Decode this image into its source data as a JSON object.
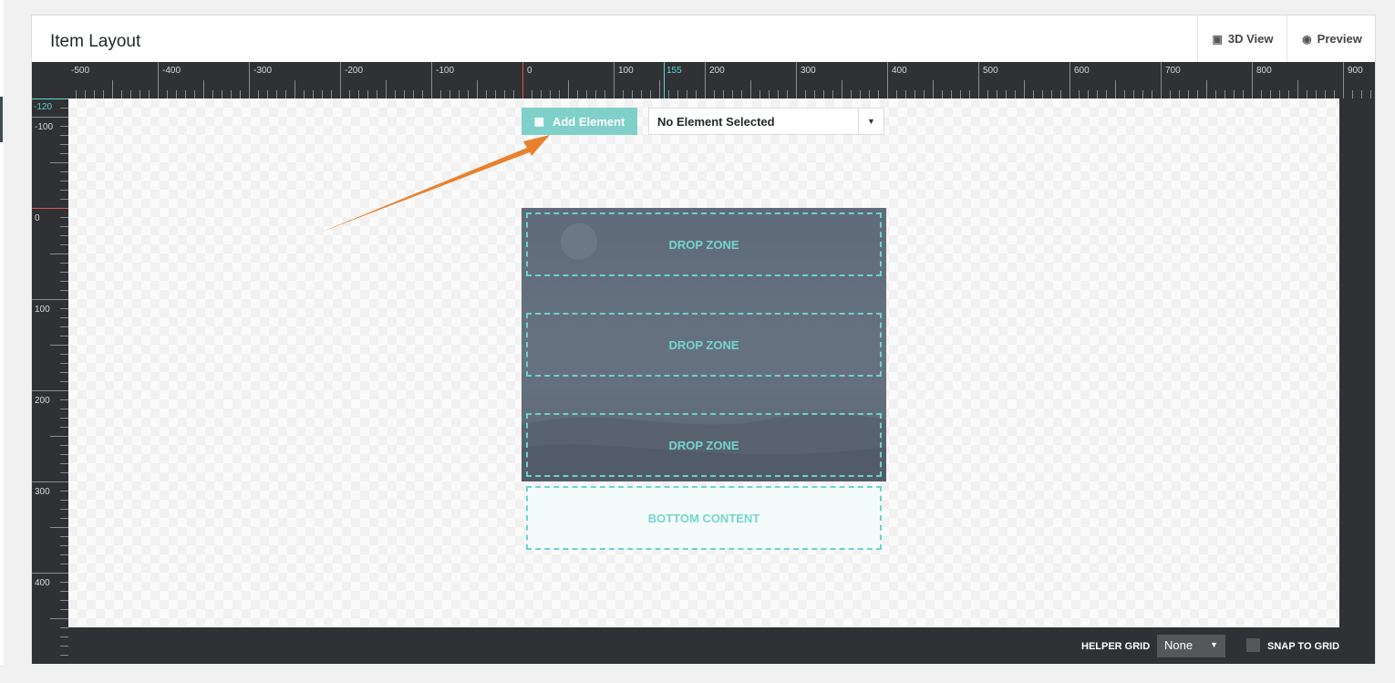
{
  "panel": {
    "title": "Item Layout",
    "view_3d_label": "3D View",
    "preview_label": "Preview",
    "view_3d_icon": "image-icon",
    "preview_icon": "eye-icon"
  },
  "ruler": {
    "top_labels": [
      "-500",
      "-400",
      "-300",
      "-200",
      "-100",
      "0",
      "100",
      "200",
      "300",
      "400",
      "500",
      "600",
      "700",
      "800",
      "900"
    ],
    "top_marker": "155",
    "left_labels": [
      "-100",
      "0",
      "100",
      "200",
      "300",
      "400"
    ],
    "left_marker": "-120",
    "marker_color": "#5fd6d8",
    "origin_color": "#d9534f"
  },
  "toolbar": {
    "add_element_label": "Add Element",
    "add_element_icon": "box-icon",
    "element_select_value": "No Element Selected"
  },
  "layout": {
    "drop_zones": [
      "DROP ZONE",
      "DROP ZONE",
      "DROP ZONE"
    ],
    "bottom_content_label": "BOTTOM CONTENT"
  },
  "footer": {
    "helper_grid_label": "HELPER GRID",
    "helper_grid_value": "None",
    "snap_to_grid_label": "SNAP TO GRID"
  },
  "colors": {
    "accent": "#7fd0c8",
    "arrow": "#e8812e",
    "editor_bg": "#2f3134",
    "card_bg": "#5f6b79"
  }
}
